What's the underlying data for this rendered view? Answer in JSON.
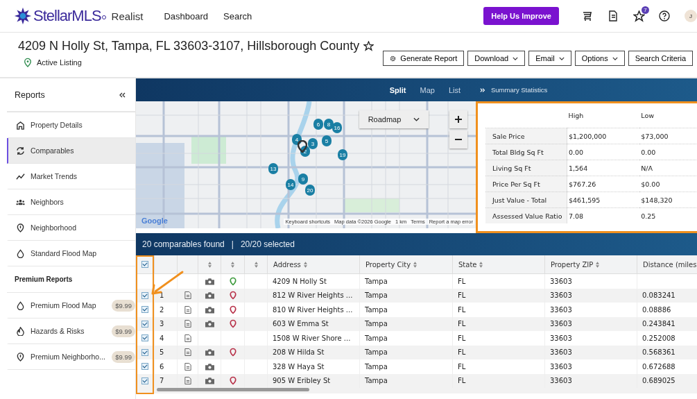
{
  "nav": {
    "brand": "StellarMLS",
    "product": "Realist",
    "links": [
      "Dashboard",
      "Search"
    ],
    "help_button": "Help Us Improve",
    "favorites_badge": "7",
    "avatar": "J"
  },
  "property": {
    "title": "4209 N Holly St, Tampa, FL 33603-3107, Hillsborough County",
    "status": "Active Listing",
    "actions": [
      {
        "label": "Generate Report",
        "kind": "icon"
      },
      {
        "label": "Download",
        "kind": "dropdown"
      },
      {
        "label": "Email",
        "kind": "dropdown"
      },
      {
        "label": "Options",
        "kind": "dropdown"
      },
      {
        "label": "Search Criteria",
        "kind": "plain"
      }
    ]
  },
  "sidebar": {
    "title": "Reports",
    "items": [
      {
        "label": "Property Details",
        "selected": false
      },
      {
        "label": "Comparables",
        "selected": true
      },
      {
        "label": "Market Trends",
        "selected": false
      },
      {
        "label": "Neighbors",
        "selected": false
      },
      {
        "label": "Neighborhood",
        "selected": false
      },
      {
        "label": "Standard Flood Map",
        "selected": false
      }
    ],
    "premium_title": "Premium Reports",
    "premium_items": [
      {
        "label": "Premium Flood Map",
        "price": "$9.99"
      },
      {
        "label": "Hazards & Risks",
        "price": "$9.99"
      },
      {
        "label": "Premium Neighborho...",
        "price": "$9.99"
      }
    ]
  },
  "view_tabs": [
    {
      "label": "Split",
      "selected": true
    },
    {
      "label": "Map",
      "selected": false
    },
    {
      "label": "List",
      "selected": false
    }
  ],
  "map": {
    "map_type": "Roadmap",
    "markers": [
      "6",
      "8",
      "16",
      "4",
      "3",
      "5",
      "2",
      "19",
      "13",
      "14",
      "9",
      "20"
    ],
    "attribution": [
      "Keyboard shortcuts",
      "Map data ©2026 Google",
      "1 km",
      "Terms",
      "Report a map error"
    ],
    "logo": "Google"
  },
  "summary": {
    "title": "Summary Statistics",
    "columns": [
      "High",
      "Low"
    ],
    "rows": [
      {
        "label": "Sale Price",
        "high": "$1,200,000",
        "low": "$73,000"
      },
      {
        "label": "Total Bldg Sq Ft",
        "high": "0.00",
        "low": "0.00"
      },
      {
        "label": "Living Sq Ft",
        "high": "1,564",
        "low": "N/A"
      },
      {
        "label": "Price Per Sq Ft",
        "high": "$767.26",
        "low": "$0.00"
      },
      {
        "label": "Just Value - Total",
        "high": "$461,595",
        "low": "$148,320"
      },
      {
        "label": "Assessed Value Ratio",
        "high": "7.08",
        "low": "0.25"
      }
    ]
  },
  "comparables": {
    "found": "20 comparables found",
    "separator": "|",
    "selected_count": "20/20 selected",
    "header_checked": true,
    "columns": [
      "Address",
      "Property City",
      "State",
      "Property ZIP",
      "Distance (miles"
    ],
    "rows": [
      {
        "kind": "subject",
        "number": "",
        "doc": false,
        "photo": true,
        "pin": {
          "color": "#3c9a3c"
        },
        "address": "4209 N Holly St",
        "city": "Tampa",
        "state": "FL",
        "zip": "33603",
        "distance": ""
      },
      {
        "kind": "comparable",
        "checked": true,
        "number": "1",
        "doc": true,
        "photo": true,
        "pin": {
          "color": "#b8324a"
        },
        "address": "812 W River Heights ...",
        "city": "Tampa",
        "state": "FL",
        "zip": "33603",
        "distance": "0.083241"
      },
      {
        "kind": "comparable",
        "checked": true,
        "number": "2",
        "doc": true,
        "photo": true,
        "pin": {
          "color": "#b8324a"
        },
        "address": "810 W River Heights ...",
        "city": "Tampa",
        "state": "FL",
        "zip": "33603",
        "distance": "0.08886"
      },
      {
        "kind": "comparable",
        "checked": true,
        "number": "3",
        "doc": true,
        "photo": true,
        "pin": {
          "color": "#b8324a"
        },
        "address": "603 W Emma St",
        "city": "Tampa",
        "state": "FL",
        "zip": "33603",
        "distance": "0.243841"
      },
      {
        "kind": "comparable",
        "checked": true,
        "number": "4",
        "doc": true,
        "photo": false,
        "address": "1508 W River Shore ...",
        "city": "Tampa",
        "state": "FL",
        "zip": "33603",
        "distance": "0.252008"
      },
      {
        "kind": "comparable",
        "checked": true,
        "number": "5",
        "doc": true,
        "photo": true,
        "pin": {
          "color": "#b8324a"
        },
        "address": "208 W Hilda St",
        "city": "Tampa",
        "state": "FL",
        "zip": "33603",
        "distance": "0.568361"
      },
      {
        "kind": "comparable",
        "checked": true,
        "number": "6",
        "doc": true,
        "photo": true,
        "address": "328 W Haya St",
        "city": "Tampa",
        "state": "FL",
        "zip": "33603",
        "distance": "0.672688"
      },
      {
        "kind": "comparable",
        "checked": true,
        "number": "7",
        "doc": true,
        "photo": true,
        "pin": {
          "color": "#b8324a"
        },
        "address": "905 W Eribley St",
        "city": "Tampa",
        "state": "FL",
        "zip": "33603",
        "distance": "0.689025"
      }
    ]
  }
}
